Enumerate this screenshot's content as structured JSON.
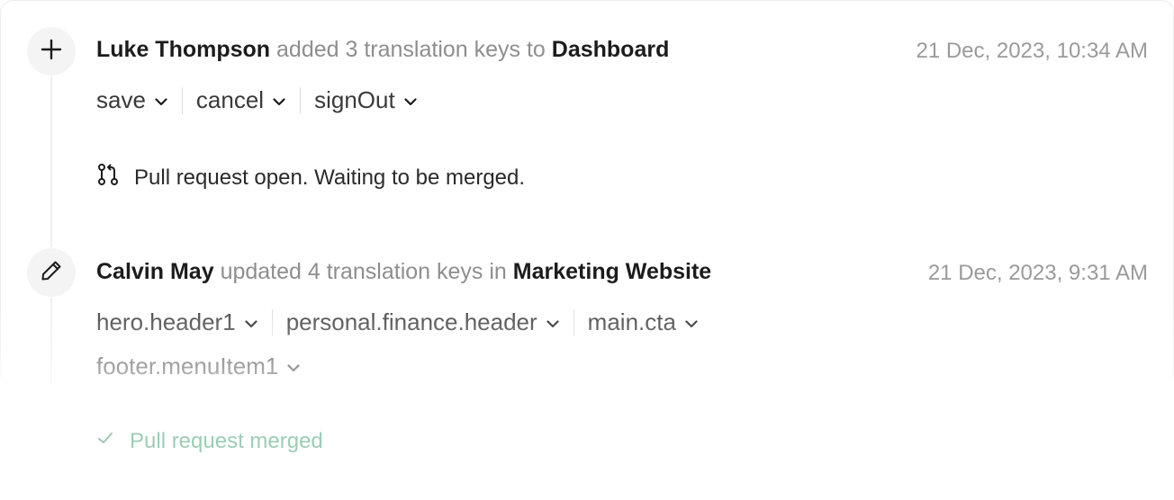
{
  "activity": [
    {
      "icon": "plus-icon",
      "user": "Luke Thompson",
      "action": "added 3 translation keys to",
      "project": "Dashboard",
      "timestamp": "21 Dec, 2023, 10:34 AM",
      "keys": [
        "save",
        "cancel",
        "signOut"
      ],
      "status": {
        "icon": "pull-request-icon",
        "text": "Pull request open. Waiting to be merged.",
        "color": "#2a2a2a"
      }
    },
    {
      "icon": "pencil-icon",
      "user": "Calvin May",
      "action": "updated 4 translation keys in",
      "project": "Marketing Website",
      "timestamp": "21 Dec, 2023, 9:31 AM",
      "keys": [
        "hero.header1",
        "personal.finance.header",
        "main.cta",
        "footer.menuItem1"
      ],
      "status": {
        "icon": "check-icon",
        "text": "Pull request merged",
        "color": "#7fb59a"
      }
    }
  ]
}
